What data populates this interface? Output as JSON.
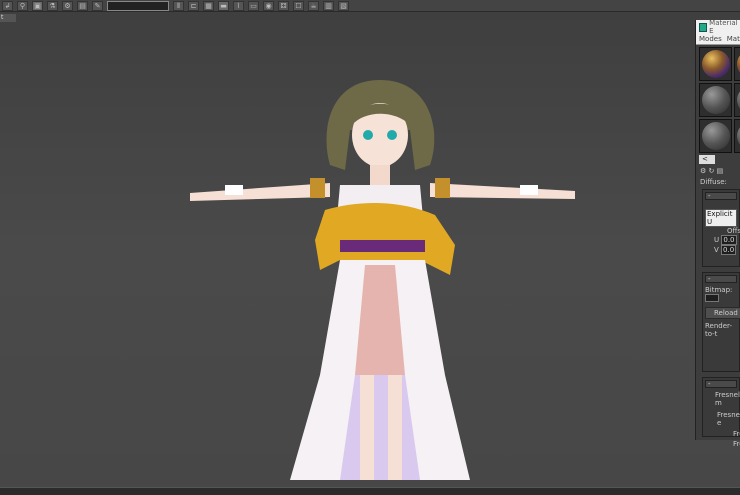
{
  "viewport": {
    "label": "t"
  },
  "material_editor": {
    "title": "Material E",
    "menu": [
      "Modes",
      "Mate"
    ],
    "scroll_left": "<",
    "diffuse_label": "Diffuse:",
    "coords": {
      "collapse": "-",
      "mapping": "Explicit U",
      "offset_label": "Offse",
      "u_label": "U",
      "u_value": "0.0",
      "v_label": "V",
      "v_value": "0.0"
    },
    "bitmap": {
      "collapse": "-",
      "bitmap_label": "Bitmap:",
      "reload": "Reload",
      "render_to": "Render-to-t"
    },
    "fresnel": {
      "collapse": "-",
      "fresnel_m": "Fresnel m",
      "fresnel_e": "Fresnel e",
      "fre1": "Fre",
      "fre2": "Fre"
    }
  }
}
